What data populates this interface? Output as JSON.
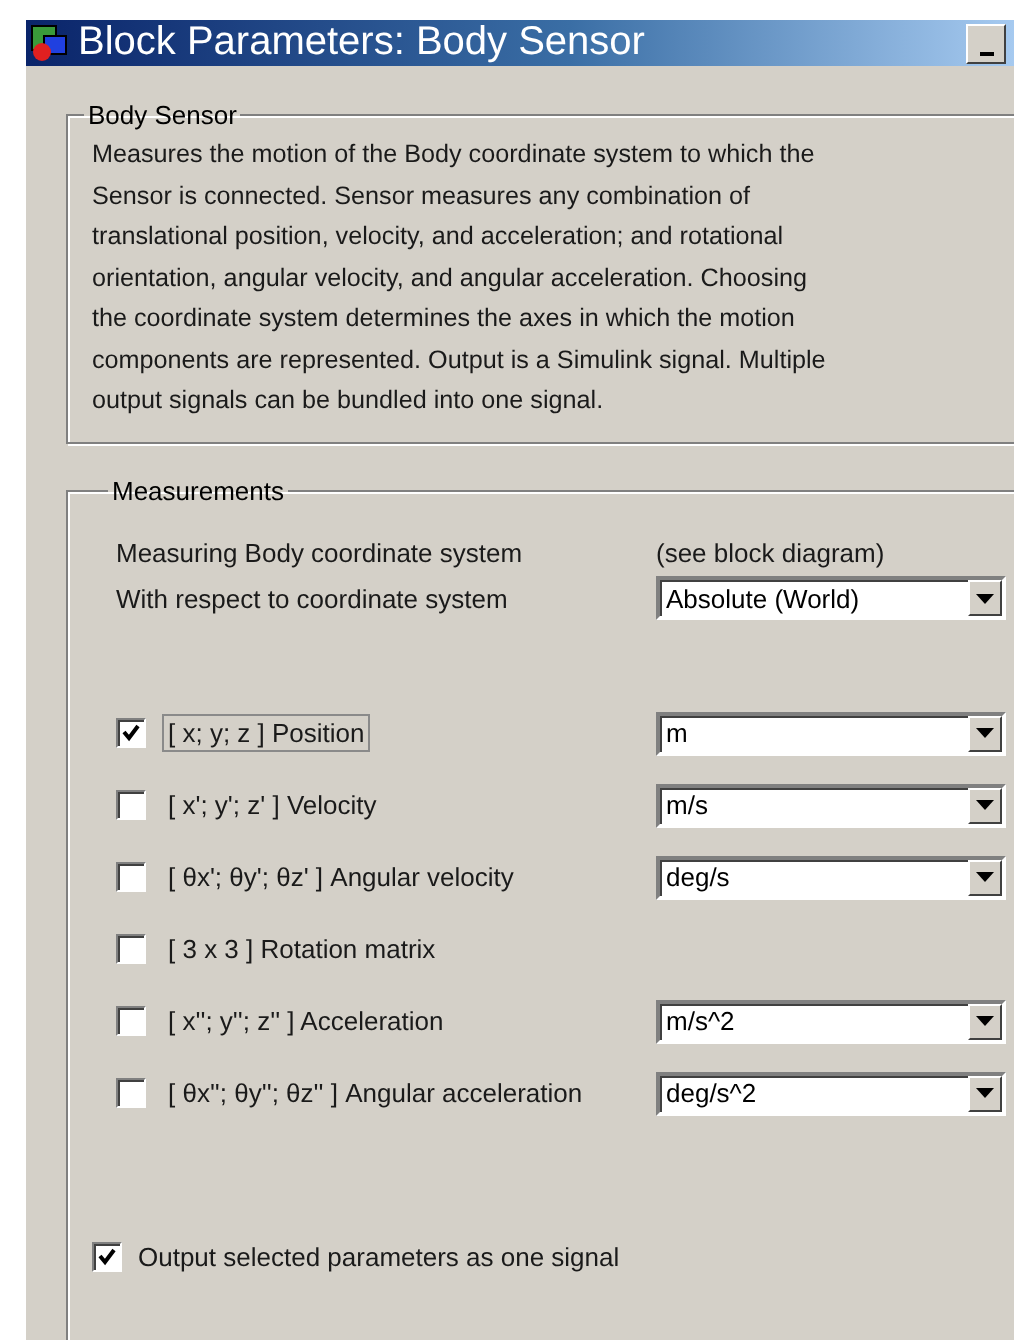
{
  "window": {
    "title": "Block Parameters: Body Sensor"
  },
  "description_group": {
    "title": "Body Sensor",
    "text": "Measures the motion of the Body coordinate system to which the\nSensor is connected. Sensor measures any combination of\ntranslational position, velocity, and acceleration; and rotational\norientation, angular velocity, and angular acceleration. Choosing\nthe coordinate system determines the axes in which the motion\ncomponents are represented. Output is a Simulink signal. Multiple\noutput signals can be bundled into one signal."
  },
  "measurements": {
    "title": "Measurements",
    "measuring_label": "Measuring Body coordinate system",
    "measuring_value": "(see block diagram)",
    "respect_label": "With respect to coordinate system",
    "respect_value": "Absolute (World)",
    "rows": [
      {
        "label": "[ x; y; z ] Position",
        "checked": true,
        "focused": true,
        "unit": "m"
      },
      {
        "label": "[ x'; y'; z' ] Velocity",
        "checked": false,
        "focused": false,
        "unit": "m/s"
      },
      {
        "label": "[ θx'; θy'; θz' ] Angular velocity",
        "checked": false,
        "focused": false,
        "unit": "deg/s"
      },
      {
        "label": "[ 3 x 3 ] Rotation matrix",
        "checked": false,
        "focused": false
      },
      {
        "label": "[ x''; y''; z'' ] Acceleration",
        "checked": false,
        "focused": false,
        "unit": "m/s^2"
      },
      {
        "label": "[ θx''; θy''; θz'' ] Angular acceleration",
        "checked": false,
        "focused": false,
        "unit": "deg/s^2"
      }
    ],
    "output": {
      "label": "Output selected parameters as one signal",
      "checked": true
    }
  }
}
